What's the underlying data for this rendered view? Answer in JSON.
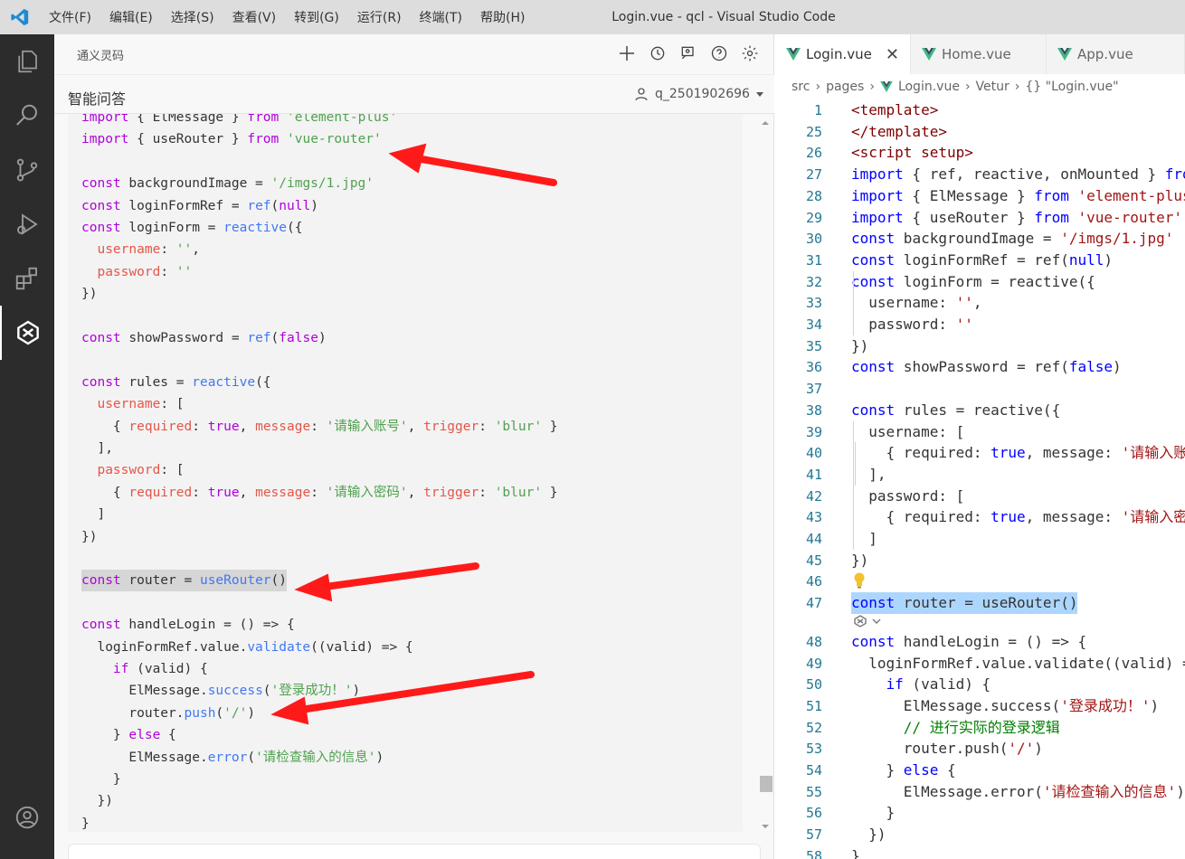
{
  "window": {
    "title": "Login.vue - qcl - Visual Studio Code"
  },
  "menu": [
    "文件(F)",
    "编辑(E)",
    "选择(S)",
    "查看(V)",
    "转到(G)",
    "运行(R)",
    "终端(T)",
    "帮助(H)"
  ],
  "panel": {
    "title": "通义灵码",
    "section": "智能问答",
    "user": "q_2501902696"
  },
  "chat_code": [
    "import { ElMessage } from 'element-plus'",
    "import { useRouter } from 'vue-router'",
    "",
    "const backgroundImage = '/imgs/1.jpg'",
    "const loginFormRef = ref(null)",
    "const loginForm = reactive({",
    "  username: '',",
    "  password: ''",
    "})",
    "",
    "const showPassword = ref(false)",
    "",
    "const rules = reactive({",
    "  username: [",
    "    { required: true, message: '请输入账号', trigger: 'blur' }",
    "  ],",
    "  password: [",
    "    { required: true, message: '请输入密码', trigger: 'blur' }",
    "  ]",
    "})",
    "",
    "const router = useRouter()",
    "",
    "const handleLogin = () => {",
    "  loginFormRef.value.validate((valid) => {",
    "    if (valid) {",
    "      ElMessage.success('登录成功！')",
    "      router.push('/')",
    "    } else {",
    "      ElMessage.error('请检查输入的信息')",
    "    }",
    "  })",
    "}"
  ],
  "editor": {
    "tabs": [
      "Login.vue",
      "Home.vue",
      "App.vue"
    ],
    "breadcrumb": [
      "src",
      "pages",
      "Login.vue",
      "Vetur",
      "{} \"Login.vue\""
    ],
    "line_numbers": [
      "1",
      "25",
      "26",
      "27",
      "28",
      "29",
      "30",
      "31",
      "32",
      "33",
      "34",
      "35",
      "36",
      "37",
      "38",
      "39",
      "40",
      "41",
      "42",
      "43",
      "44",
      "45",
      "46",
      "47",
      "48",
      "49",
      "50",
      "51",
      "52",
      "53",
      "54",
      "55",
      "56",
      "57",
      "58"
    ],
    "lines": [
      "<template>",
      "</template>",
      "<script setup>",
      "import { ref, reactive, onMounted } from 'vue'",
      "import { ElMessage } from 'element-plus'",
      "import { useRouter } from 'vue-router'",
      "const backgroundImage = '/imgs/1.jpg'",
      "const loginFormRef = ref(null)",
      "const loginForm = reactive({",
      "  username: '',",
      "  password: ''",
      "})",
      "const showPassword = ref(false)",
      "",
      "const rules = reactive({",
      "  username: [",
      "    { required: true, message: '请输入账号', trigger: 'blur' }",
      "  ],",
      "  password: [",
      "    { required: true, message: '请输入密码', trigger: 'blur' }",
      "  ]",
      "})",
      "",
      "const router = useRouter()",
      "const handleLogin = () => {",
      "  loginFormRef.value.validate((valid) => {",
      "    if (valid) {",
      "      ElMessage.success('登录成功！')",
      "      // 进行实际的登录逻辑",
      "      router.push('/')",
      "    } else {",
      "      ElMessage.error('请检查输入的信息')",
      "    }",
      "  })",
      "}"
    ]
  },
  "icons": [
    "vscode-logo-icon",
    "explorer-icon",
    "search-icon",
    "source-control-icon",
    "run-debug-icon",
    "extensions-icon",
    "tongyi-icon",
    "account-icon"
  ]
}
